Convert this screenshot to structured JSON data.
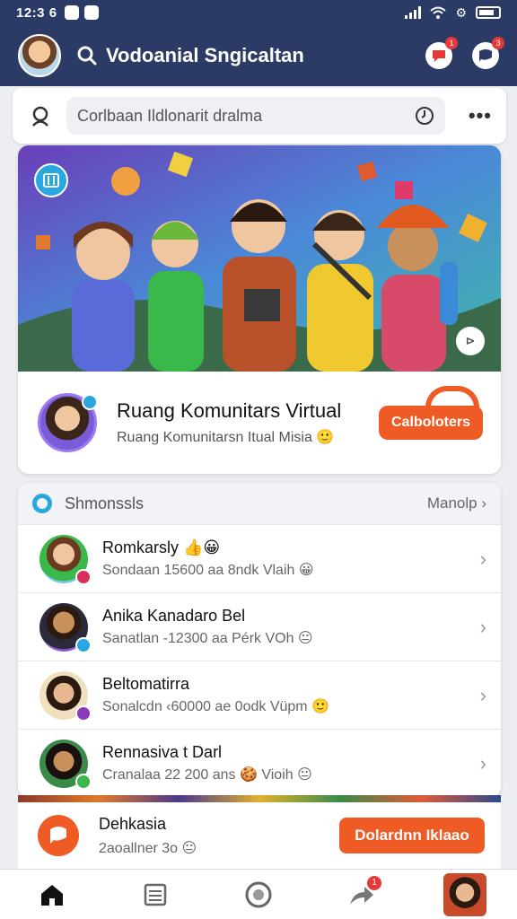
{
  "status_bar": {
    "time": "12:3 6",
    "battery_level": 0.8
  },
  "header": {
    "title": "Vodoanial Sngicaltan",
    "notification_count": "1",
    "message_count": "3"
  },
  "search": {
    "placeholder": "Corlbaan Ildlonarit dralma"
  },
  "hero": {
    "title": "Ruang Komunitars Virtual",
    "subtitle": "Ruang Komunitarsn Itual Misia 🙂",
    "button_label": "Calboloters"
  },
  "list": {
    "header_label": "Shmonssls",
    "header_link": "Manolp ›",
    "items": [
      {
        "name": "Romkarsly 👍😀",
        "meta": "Sondaan 15600 aa 8ndk Vlaih 😀"
      },
      {
        "name": "Anika Kanadaro Bel",
        "meta": "Sanatlan -12300 aa Pérk VOh 😐"
      },
      {
        "name": "Beltomatirra",
        "meta": "Sonalcdn ‹60000 ae 0odk Vüpm 🙂"
      },
      {
        "name": "Rennasiva t Darl",
        "meta": "Cranalaa 22 200 ans 🍪 Vioih 😐"
      }
    ]
  },
  "promo": {
    "title": "Dehkasia",
    "subtitle": "2aoallner 3o 😐",
    "button_label": "Dolardnn Iklaao"
  },
  "bottom_nav": {
    "badge": "1"
  },
  "colors": {
    "header_bg": "#2c3a66",
    "accent_orange": "#ee5b24",
    "accent_blue": "#29a7e1",
    "badge_red": "#e53935"
  }
}
